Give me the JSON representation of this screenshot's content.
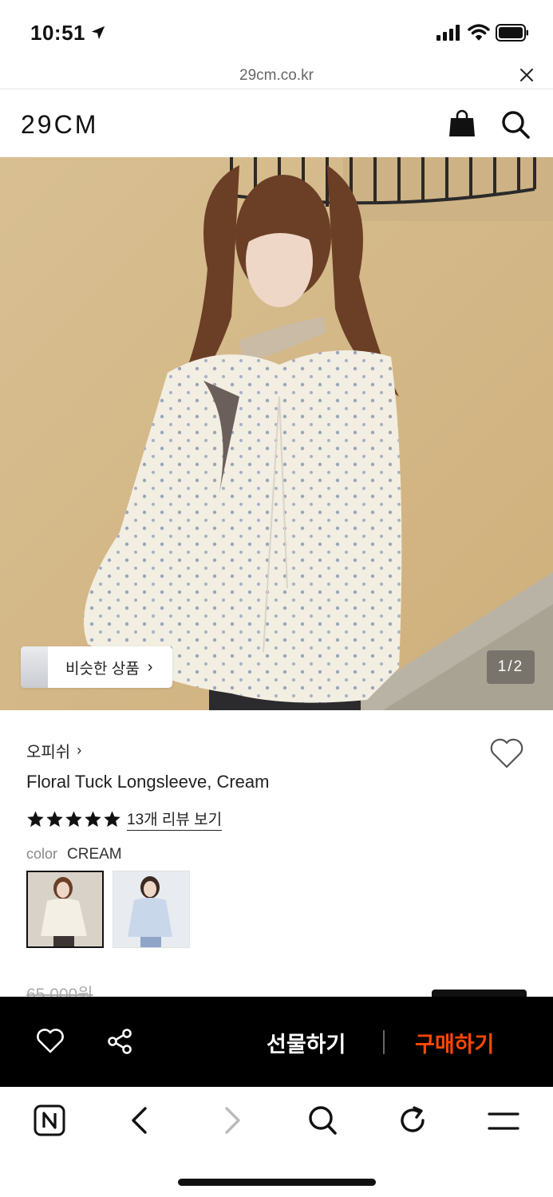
{
  "status_bar": {
    "time": "10:51"
  },
  "browser": {
    "url": "29cm.co.kr"
  },
  "header": {
    "logo": "29CM"
  },
  "hero": {
    "similar_label": "비슷한 상품",
    "similar_chevron": "›",
    "pager": "1/2"
  },
  "product": {
    "brand": "오피쉬",
    "brand_chevron": "›",
    "name": "Floral Tuck Longsleeve, Cream",
    "rating_stars": 5,
    "review_link": "13개 리뷰 보기",
    "color_label": "color",
    "color_value": "CREAM",
    "original_price": "65,000원"
  },
  "action_bar": {
    "gift_label": "선물하기",
    "buy_label": "구매하기",
    "buy_color": "#ff4800"
  },
  "icons": [
    "location-arrow-icon",
    "signal-icon",
    "wifi-icon",
    "battery-icon",
    "close-icon",
    "shopping-bag-icon",
    "search-icon",
    "heart-icon",
    "share-icon",
    "naver-icon",
    "back-icon",
    "forward-icon",
    "refresh-icon",
    "menu-icon"
  ]
}
